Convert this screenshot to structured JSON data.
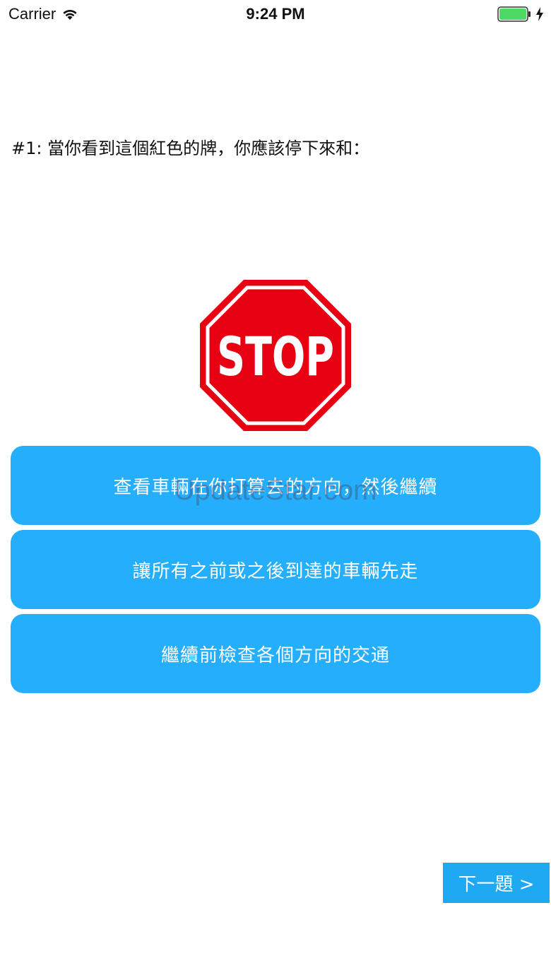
{
  "status_bar": {
    "carrier": "Carrier",
    "time": "9:24 PM",
    "icons": [
      "wifi-icon",
      "battery-icon",
      "charging-bolt-icon"
    ],
    "battery_color": "#4CD964"
  },
  "question": {
    "text": "#1: 當你看到這個紅色的牌，你應該停下來和："
  },
  "sign": {
    "text": "STOP",
    "color": "#E60012"
  },
  "answers": [
    {
      "label": "查看車輛在你打算去的方向，然後繼續"
    },
    {
      "label": "讓所有之前或之後到達的車輛先走"
    },
    {
      "label": "繼續前檢查各個方向的交通"
    }
  ],
  "answer_color": "#24AEFB",
  "watermark": "UpdateStar.com",
  "next_button": {
    "label": "下一題 >"
  }
}
